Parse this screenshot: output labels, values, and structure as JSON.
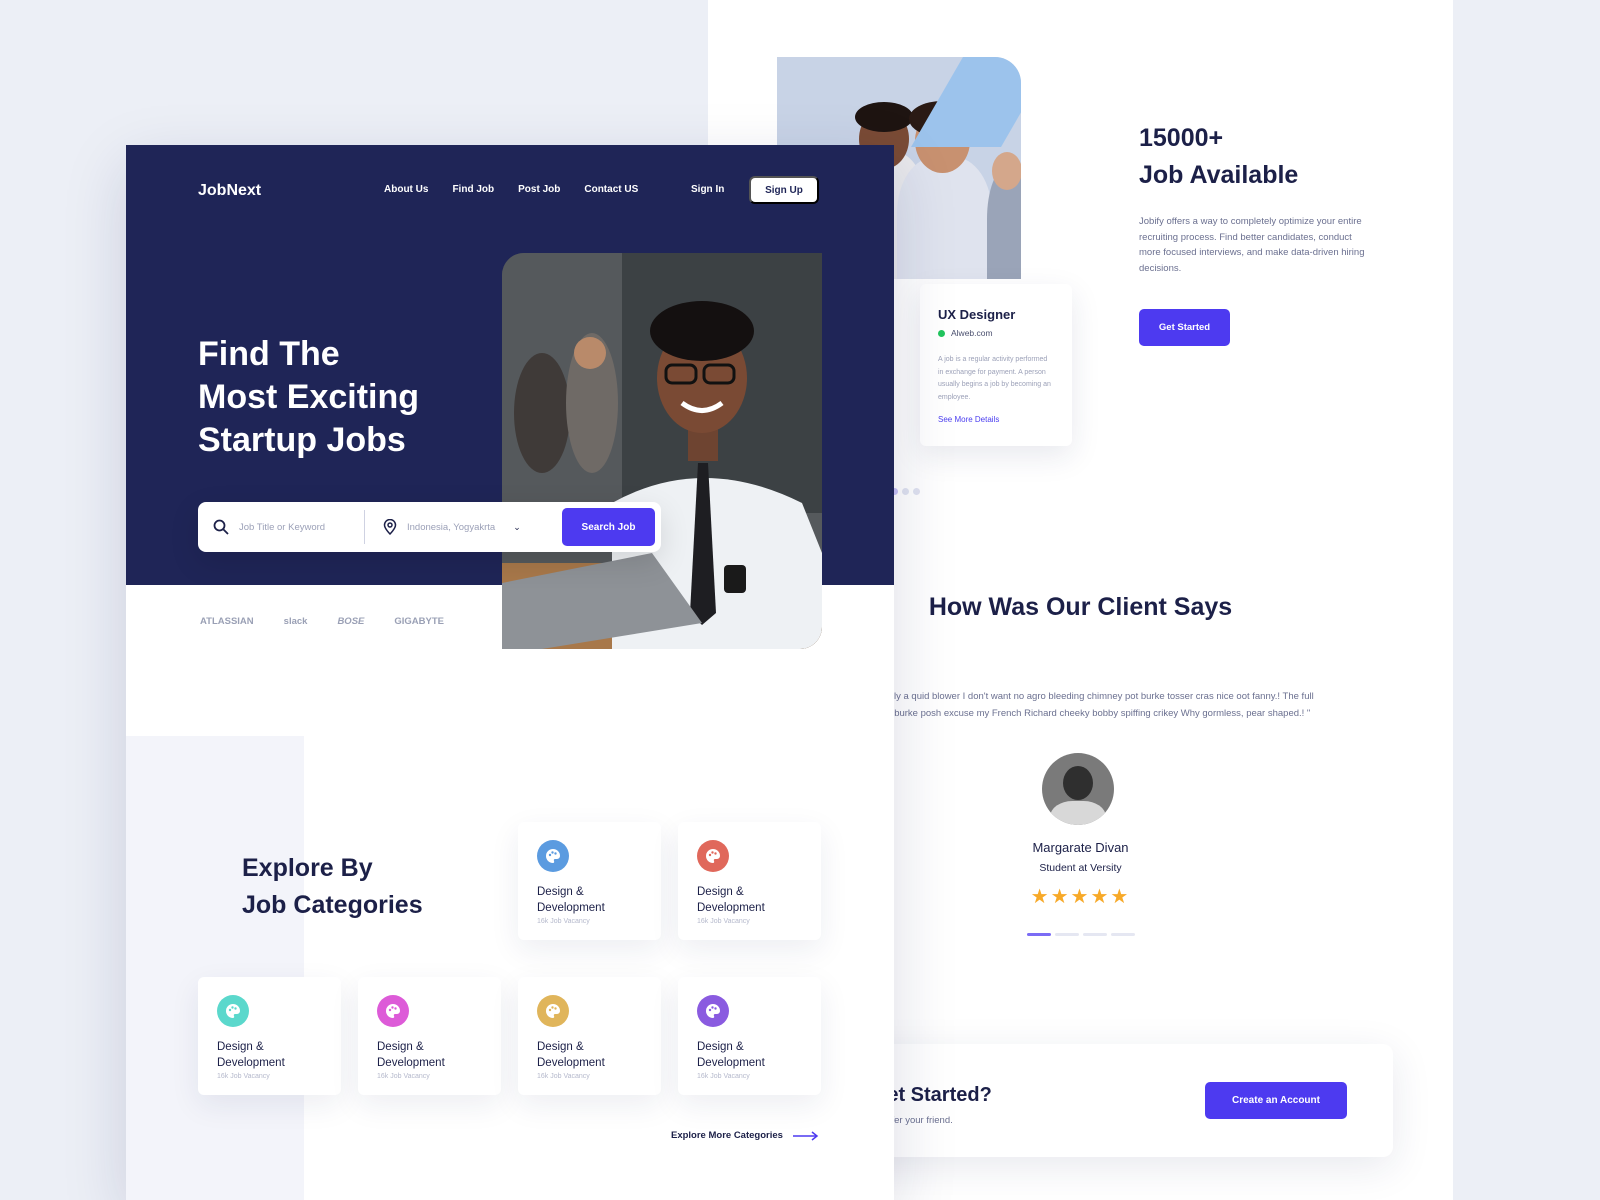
{
  "front": {
    "logo": "JobNext",
    "nav": [
      "About Us",
      "Find Job",
      "Post Job",
      "Contact US"
    ],
    "sign_in": "Sign In",
    "sign_up": "Sign Up",
    "hero_title_lines": [
      "Find The",
      "Most Exciting",
      "Startup Jobs"
    ],
    "search": {
      "keyword_placeholder": "Job Title or Keyword",
      "location": "Indonesia, Yogyakrta",
      "button": "Search Job"
    },
    "brands": [
      "ATLASSIAN",
      "slack",
      "BOSE",
      "GIGABYTE"
    ],
    "categories_title_lines": [
      "Explore By",
      "Job Categories"
    ],
    "categories": [
      {
        "name": "Design & Development",
        "vacancy": "16k Job Vacancy",
        "color": "#5b9be0"
      },
      {
        "name": "Design & Development",
        "vacancy": "16k Job Vacancy",
        "color": "#e0685b"
      },
      {
        "name": "Design & Development",
        "vacancy": "16k Job Vacancy",
        "color": "#5bd8cc"
      },
      {
        "name": "Design & Development",
        "vacancy": "16k Job Vacancy",
        "color": "#dd5bd8"
      },
      {
        "name": "Design & Development",
        "vacancy": "16k Job Vacancy",
        "color": "#e0b55b"
      },
      {
        "name": "Design & Development",
        "vacancy": "16k Job Vacancy",
        "color": "#8a5be0"
      }
    ],
    "explore_more": "Explore More Categories"
  },
  "back": {
    "jobs_title_lines": [
      "15000+",
      "Job Available"
    ],
    "jobs_desc": "Jobify offers a way to completely optimize your entire recruiting process. Find better candidates, conduct more focused interviews, and make data-driven hiring decisions.",
    "get_started": "Get Started",
    "job_card": {
      "title": "UX Designer",
      "company": "Alweb.com",
      "desc": "A job is a regular activity performed in exchange for payment. A person usually begins a job by becoming an employee.",
      "more": "See More Details"
    },
    "client_title": "How Was Our Client Says",
    "quote": "bout only a quid blower I don't want no agro bleeding chimney pot burke tosser cras nice oot fanny.! The full monty burke posh excuse my French Richard cheeky bobby spiffing crikey Why gormless, pear shaped.! \"",
    "client_name": "Margarate Divan",
    "client_role": "Student at Versity",
    "rating": 5,
    "stars": "★★★★★",
    "cta_title": "o Get Started?",
    "cta_sub": "nt and refer your friend.",
    "create_account": "Create an Account"
  },
  "colors": {
    "navy": "#1f2557",
    "accent": "#4d3af0",
    "star": "#f7a928",
    "online": "#22c55e"
  }
}
